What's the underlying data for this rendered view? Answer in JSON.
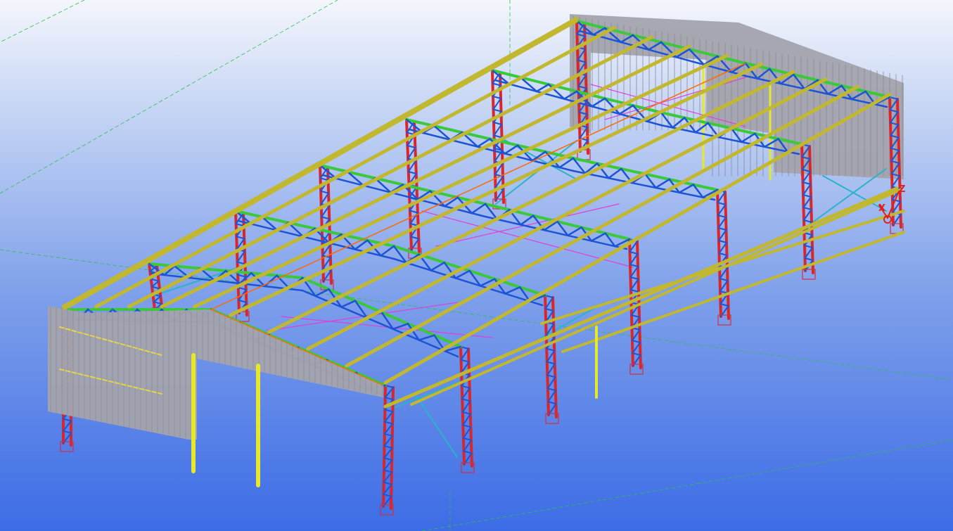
{
  "view": {
    "background_top": "#f4f6fc",
    "background_bottom": "#3c6ce6"
  },
  "axes": {
    "x_label": "X",
    "z_label": "Z",
    "color": "#e02020"
  },
  "colors": {
    "column": "#d9262b",
    "column_lacing": "#1d54d6",
    "truss_chord": "#39c93a",
    "truss_web": "#1d54d6",
    "purlin": "#c2b830",
    "wind_column": "#e8e82a",
    "cladding": "#a3a3ad",
    "bracing": "#2ab3c9",
    "roof_bracing": "#e040d8",
    "ridge": "#ff6a00",
    "gridline": "#2cc04a"
  }
}
